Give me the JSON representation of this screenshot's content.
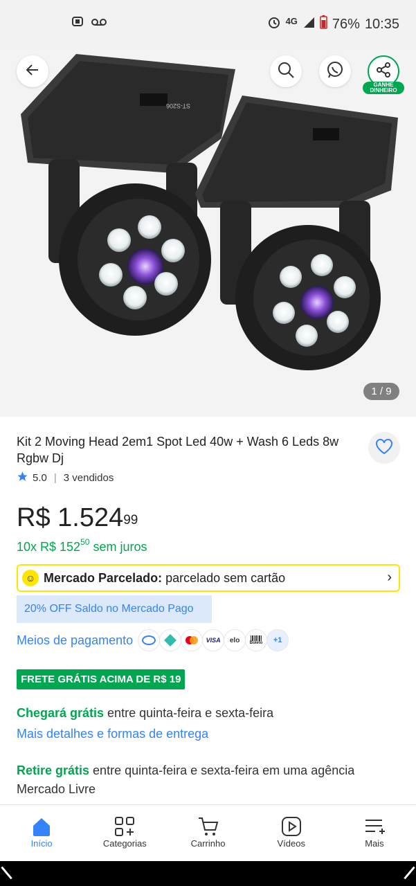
{
  "status_bar": {
    "network": "4G",
    "battery": "76%",
    "time": "10:35"
  },
  "gallery": {
    "counter": "1 / 9",
    "share_badge_line1": "GANHE",
    "share_badge_line2": "DINHEIRO",
    "product_label": "ST-S206"
  },
  "product": {
    "title": "Kit 2 Moving Head 2em1 Spot Led 40w + Wash 6 Leds 8w Rgbw Dj",
    "rating": "5.0",
    "sold": "3 vendidos",
    "price_main": "R$ 1.524",
    "price_cents": "99",
    "installments_prefix": "10x R$ 152",
    "installments_cents": "50",
    "installments_suffix": " sem juros"
  },
  "parcelado": {
    "bold": "Mercado Parcelado:",
    "text": " parcelado sem cartão"
  },
  "discount_banner": "20% OFF Saldo no Mercado Pago",
  "payment": {
    "label": "Meios de pagamento",
    "methods": [
      "mercado-pago",
      "pix",
      "mastercard",
      "VISA",
      "elo",
      "Boleto",
      "+1"
    ]
  },
  "shipping_badge": "FRETE GRÁTIS ACIMA DE R$ 19",
  "delivery": {
    "arrives_bold": "Chegará grátis",
    "arrives_text": " entre quinta-feira e sexta-feira",
    "more_details": "Mais detalhes e formas de entrega",
    "pickup_bold": "Retire grátis",
    "pickup_text": " entre quinta-feira e sexta-feira em uma agência Mercado Livre"
  },
  "nav": [
    {
      "label": "Início",
      "icon": "home-icon"
    },
    {
      "label": "Categorias",
      "icon": "categories-icon"
    },
    {
      "label": "Carrinho",
      "icon": "cart-icon"
    },
    {
      "label": "Vídeos",
      "icon": "video-icon"
    },
    {
      "label": "Mais",
      "icon": "menu-icon"
    }
  ],
  "colors": {
    "brand_blue": "#3483fa",
    "green": "#00a650",
    "yellow": "#ffe600"
  }
}
